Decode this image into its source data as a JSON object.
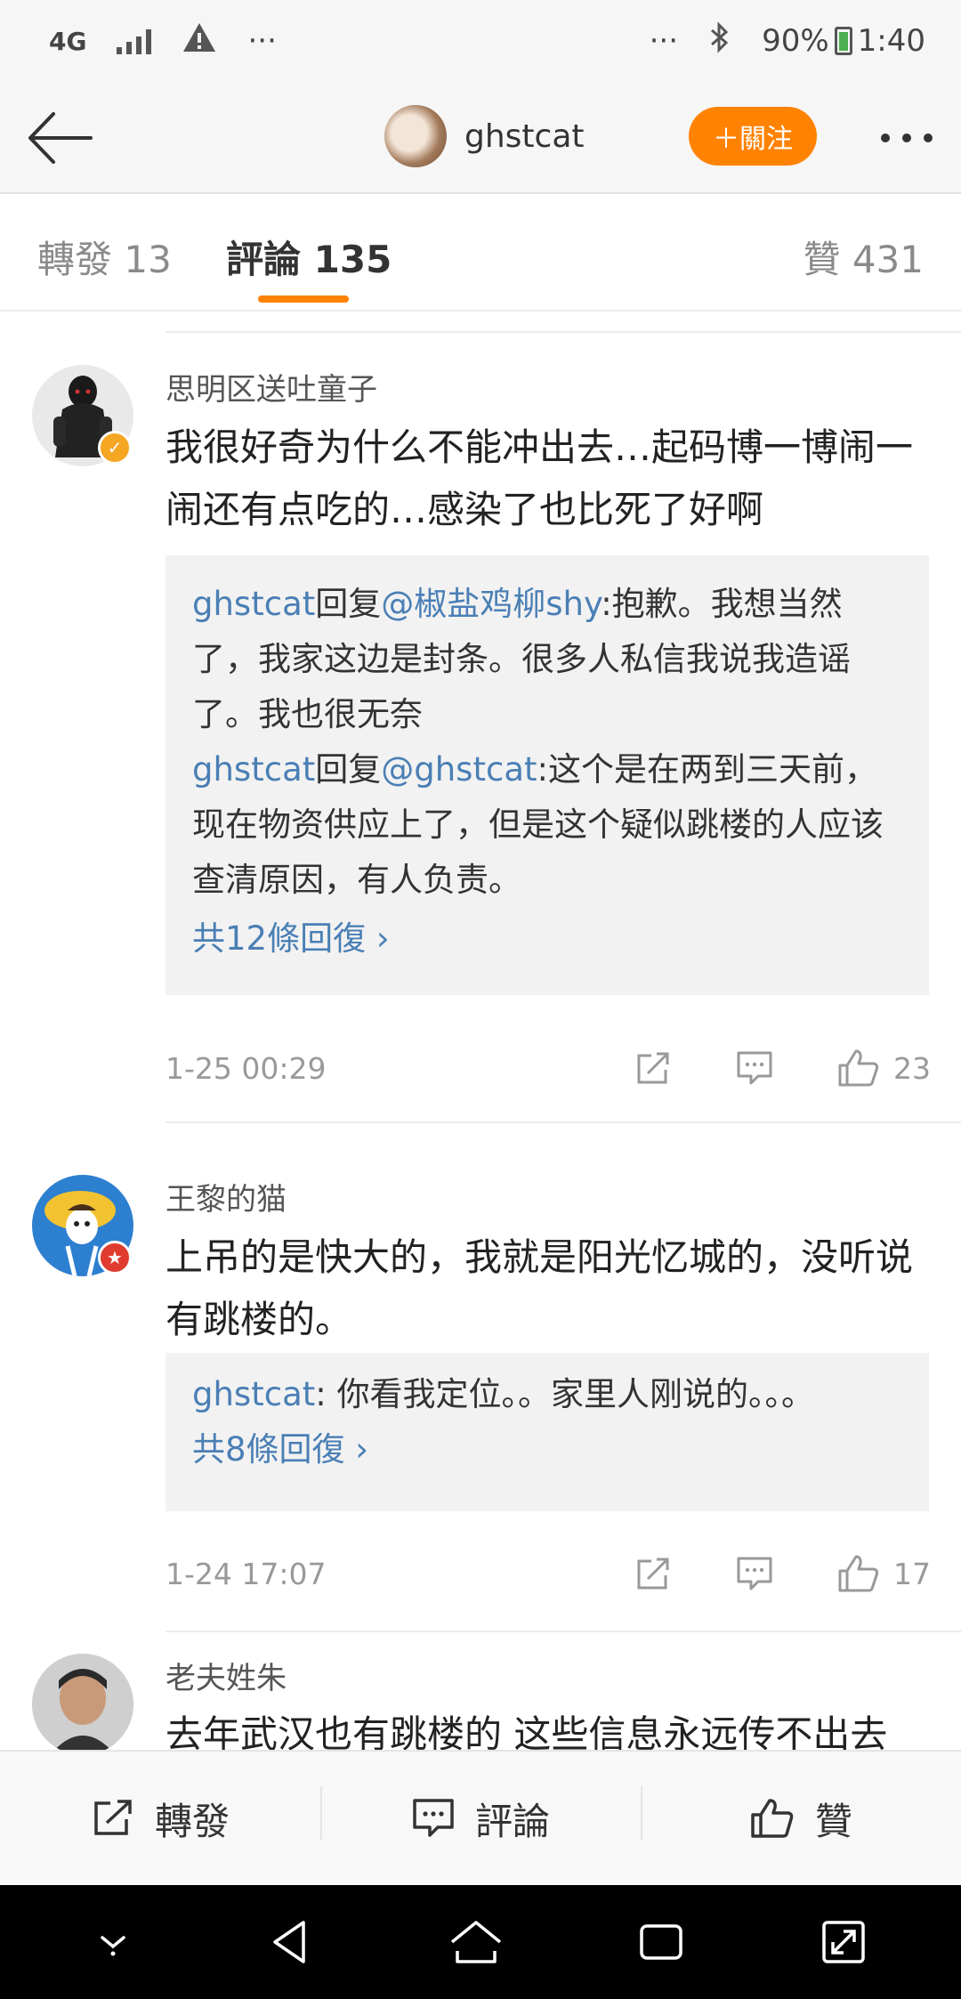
{
  "status_bar": {
    "network": "4G",
    "battery": "90%",
    "time": "1:40",
    "left_more": "···",
    "right_more": "···"
  },
  "header": {
    "username": "ghstcat",
    "follow_label": "＋關注"
  },
  "tabs": [
    {
      "label": "轉發 13"
    },
    {
      "label": "評論 135"
    },
    {
      "label": "贊 431"
    }
  ],
  "comments": [
    {
      "author": "思明区送吐童子",
      "text": "我很好奇为什么不能冲出去…起码博一博闹一闹还有点吃的…感染了也比死了好啊",
      "replies": [
        {
          "name": "ghstcat",
          "mid": "回复",
          "mention": "@椒盐鸡柳shy",
          "text": ":抱歉。我想当然了，我家这边是封条。很多人私信我说我造谣了。我也很无奈"
        },
        {
          "name": "ghstcat",
          "mid": "回复",
          "mention": "@ghstcat",
          "text": ":这个是在两到三天前，现在物资供应上了，但是这个疑似跳楼的人应该查清原因，有人负责。"
        }
      ],
      "more_replies": "共12條回復 ›",
      "date": "1-25 00:29",
      "likes": "23"
    },
    {
      "author": "王黎的猫",
      "text": "上吊的是快大的，我就是阳光忆城的，没听说有跳楼的。",
      "replies": [
        {
          "name": "ghstcat",
          "mid": "",
          "mention": "",
          "text": ": 你看我定位。。家里人刚说的。。。"
        }
      ],
      "more_replies": "共8條回復 ›",
      "date": "1-24 17:07",
      "likes": "17"
    },
    {
      "author": "老夫姓朱",
      "text": "去年武汉也有跳楼的 这些信息永远传不出去"
    }
  ],
  "bottom_bar": {
    "repost_label": "轉發",
    "comment_label": "評論",
    "like_label": "贊"
  },
  "colors": {
    "accent": "#ff8200",
    "link": "#4a7fb5",
    "verified_badge": "#f5a623",
    "red_badge": "#e03b2f"
  }
}
